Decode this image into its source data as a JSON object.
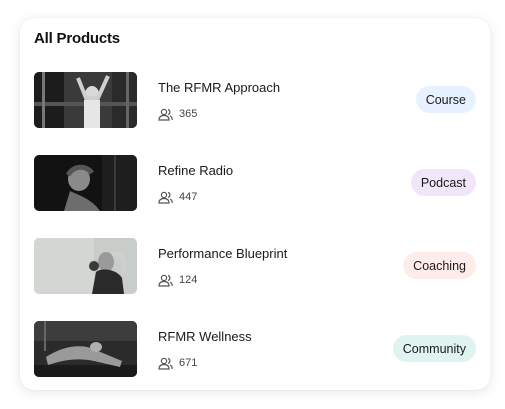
{
  "header": {
    "title": "All Products"
  },
  "products": [
    {
      "name": "The RFMR Approach",
      "members": "365",
      "type": "Course",
      "badge_color": "#e7f1ff",
      "image": "woman-stretching-arms-gym"
    },
    {
      "name": "Refine Radio",
      "members": "447",
      "type": "Podcast",
      "badge_color": "#f1e5f9",
      "image": "woman-profile-dark-studio"
    },
    {
      "name": "Performance Blueprint",
      "members": "124",
      "type": "Coaching",
      "badge_color": "#fdecea",
      "image": "woman-ponytail-light-background"
    },
    {
      "name": "RFMR Wellness",
      "members": "671",
      "type": "Community",
      "badge_color": "#dff4f1",
      "image": "woman-yoga-stretch-dark"
    }
  ],
  "icons": {
    "members": "users-icon"
  }
}
